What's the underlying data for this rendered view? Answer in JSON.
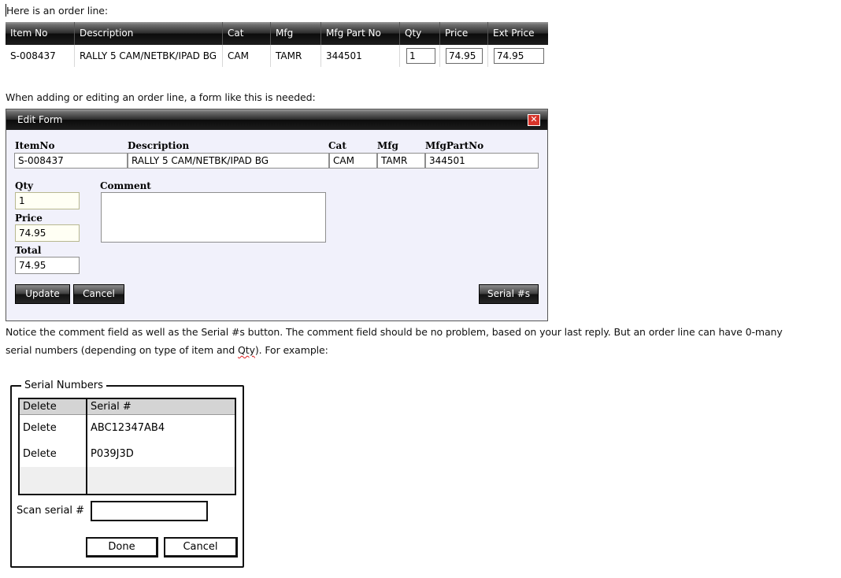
{
  "intro": {
    "text": "Here is an order line:"
  },
  "order_grid": {
    "headers": [
      "Item No",
      "Description",
      "Cat",
      "Mfg",
      "Mfg Part No",
      "Qty",
      "Price",
      "Ext Price"
    ],
    "row": {
      "item_no": "S-008437",
      "description": "RALLY 5 CAM/NETBK/IPAD BG",
      "cat": "CAM",
      "mfg": "TAMR",
      "mfg_part_no": "344501",
      "qty": "1",
      "price": "74.95",
      "ext_price": "74.95"
    }
  },
  "form_intro": {
    "text": "When adding or editing an order line, a form like this is needed:"
  },
  "edit_form": {
    "title": "Edit Form",
    "close_glyph": "✕",
    "labels": {
      "item_no": "ItemNo",
      "description": "Description",
      "cat": "Cat",
      "mfg": "Mfg",
      "mfg_part_no": "MfgPartNo",
      "qty": "Qty",
      "comment": "Comment",
      "price": "Price",
      "total": "Total"
    },
    "values": {
      "item_no": "S-008437",
      "description": "RALLY 5 CAM/NETBK/IPAD BG",
      "cat": "CAM",
      "mfg": "TAMR",
      "mfg_part_no": "344501",
      "qty": "1",
      "price": "74.95",
      "total": "74.95",
      "comment": ""
    },
    "buttons": {
      "update": "Update",
      "cancel": "Cancel",
      "serials": "Serial #s"
    }
  },
  "notice": {
    "line1": "Notice the comment field as well as the Serial #s button.  The comment field should be no problem, based on your last reply.  But an order line can have 0-many",
    "line2_before": "serial numbers (depending on type of item and ",
    "line2_spell": "Qty",
    "line2_after": ").  For example:"
  },
  "serial_numbers": {
    "legend": "Serial Numbers",
    "headers": {
      "delete": "Delete",
      "serial": "Serial #"
    },
    "rows": [
      {
        "delete": "Delete",
        "serial": "ABC12347AB4"
      },
      {
        "delete": "Delete",
        "serial": "P039J3D"
      }
    ],
    "scan_label": "Scan serial #",
    "scan_value": "",
    "buttons": {
      "done": "Done",
      "cancel": "Cancel"
    }
  },
  "colors": {
    "header_dark": "#1d1d1d",
    "form_background": "#f1f1fb",
    "close_red": "#d8342a"
  }
}
